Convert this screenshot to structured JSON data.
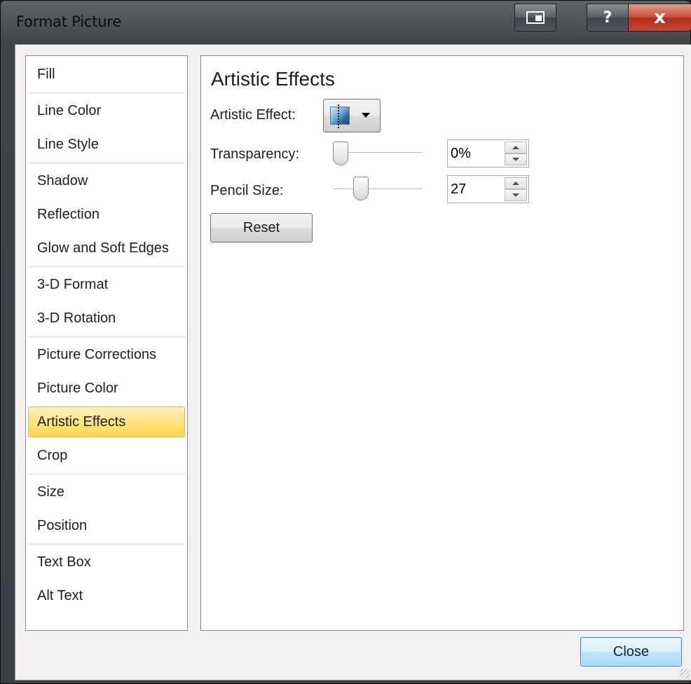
{
  "window": {
    "title": "Format Picture",
    "controls": {
      "help_label": "?",
      "close_label": "x"
    }
  },
  "sidebar": {
    "items": [
      {
        "label": "Fill"
      },
      {
        "label": "Line Color"
      },
      {
        "label": "Line Style"
      },
      {
        "label": "Shadow"
      },
      {
        "label": "Reflection"
      },
      {
        "label": "Glow and Soft Edges"
      },
      {
        "label": "3-D Format"
      },
      {
        "label": "3-D Rotation"
      },
      {
        "label": "Picture Corrections"
      },
      {
        "label": "Picture Color"
      },
      {
        "label": "Artistic Effects",
        "selected": true
      },
      {
        "label": "Crop"
      },
      {
        "label": "Size"
      },
      {
        "label": "Position"
      },
      {
        "label": "Text Box"
      },
      {
        "label": "Alt Text"
      }
    ]
  },
  "panel": {
    "title": "Artistic Effects",
    "artistic_effect": {
      "label": "Artistic Effect:",
      "icon": "pencil-sketch-effect-thumbnail"
    },
    "transparency": {
      "label": "Transparency:",
      "value": "0%",
      "slider_fraction": 0.0
    },
    "pencil_size": {
      "label": "Pencil Size:",
      "value": "27",
      "slider_fraction": 0.27
    },
    "reset_label": "Reset"
  },
  "footer": {
    "close_label": "Close"
  },
  "colors": {
    "selected_item": "#ffd755",
    "title_close_button": "#c9503d",
    "default_button": "#bee6fd"
  }
}
